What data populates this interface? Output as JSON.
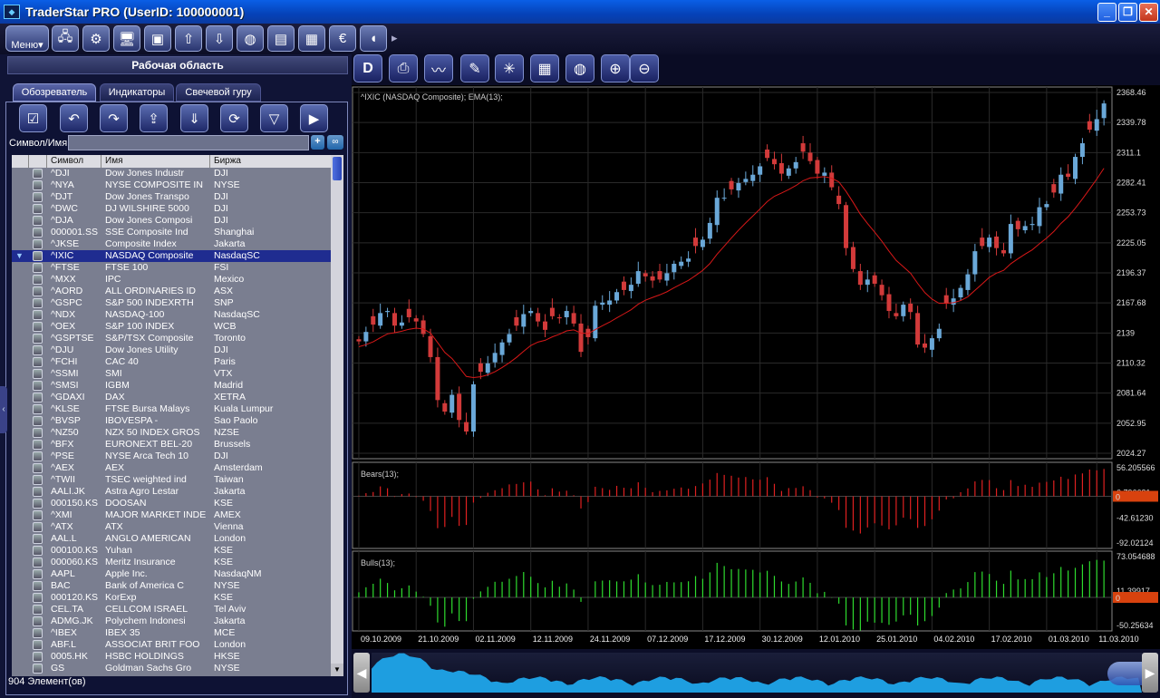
{
  "window": {
    "title": "TraderStar PRO (UserID: 100000001)",
    "app_icon": "ts-logo-icon",
    "minimize": "_",
    "maximize": "❐",
    "close": "✕"
  },
  "toolbar": {
    "menu_label": "Меню",
    "icons": [
      "network-icon",
      "settings-icon",
      "monitor-icon",
      "display-icon",
      "upload-icon",
      "download-icon",
      "globe-icon",
      "book-icon",
      "newspaper-icon",
      "euro-icon",
      "speaker-icon"
    ],
    "more": "▸"
  },
  "left_panel": {
    "title": "Рабочая область",
    "tabs": [
      "Обозреватель",
      "Индикаторы",
      "Свечевой гуру"
    ],
    "active_tab": 0,
    "symbol_label": "Символ/Имя:",
    "symbol_value": "",
    "columns": [
      "Символ",
      "Имя",
      "Биржа"
    ],
    "rows": [
      [
        "^DJI",
        "Dow Jones Industr",
        "DJI"
      ],
      [
        "^NYA",
        "NYSE COMPOSITE IN",
        "NYSE"
      ],
      [
        "^DJT",
        "Dow Jones Transpo",
        "DJI"
      ],
      [
        "^DWC",
        "DJ WILSHIRE 5000",
        "DJI"
      ],
      [
        "^DJA",
        "Dow Jones Composi",
        "DJI"
      ],
      [
        "000001.SS",
        "SSE Composite Ind",
        "Shanghai"
      ],
      [
        "^JKSE",
        "Composite Index",
        "Jakarta"
      ],
      [
        "^IXIC",
        "NASDAQ Composite",
        "NasdaqSC"
      ],
      [
        "^FTSE",
        "FTSE 100",
        "FSI"
      ],
      [
        "^MXX",
        "IPC",
        "Mexico"
      ],
      [
        "^AORD",
        "ALL ORDINARIES ID",
        "ASX"
      ],
      [
        "^GSPC",
        "S&P 500 INDEXRTH",
        "SNP"
      ],
      [
        "^NDX",
        "NASDAQ-100",
        "NasdaqSC"
      ],
      [
        "^OEX",
        "S&P 100 INDEX",
        "WCB"
      ],
      [
        "^GSPTSE",
        "S&P/TSX Composite",
        "Toronto"
      ],
      [
        "^DJU",
        "Dow Jones Utility",
        "DJI"
      ],
      [
        "^FCHI",
        "CAC 40",
        "Paris"
      ],
      [
        "^SSMI",
        "SMI",
        "VTX"
      ],
      [
        "^SMSI",
        "IGBM",
        "Madrid"
      ],
      [
        "^GDAXI",
        "DAX",
        "XETRA"
      ],
      [
        "^KLSE",
        "FTSE Bursa Malays",
        "Kuala Lumpur"
      ],
      [
        "^BVSP",
        "IBOVESPA    -",
        "Sao Paolo"
      ],
      [
        "^NZ50",
        "NZX 50 INDEX GROS",
        "NZSE"
      ],
      [
        "^BFX",
        "EURONEXT BEL-20",
        "Brussels"
      ],
      [
        "^PSE",
        "NYSE Arca Tech 10",
        "DJI"
      ],
      [
        "^AEX",
        "AEX",
        "Amsterdam"
      ],
      [
        "^TWII",
        "TSEC weighted ind",
        "Taiwan"
      ],
      [
        "AALI.JK",
        "Astra Agro Lestar",
        "Jakarta"
      ],
      [
        "000150.KS",
        "DOOSAN",
        "KSE"
      ],
      [
        "^XMI",
        "MAJOR MARKET INDE",
        "AMEX"
      ],
      [
        "^ATX",
        "ATX",
        "Vienna"
      ],
      [
        "AAL.L",
        "ANGLO AMERICAN",
        "London"
      ],
      [
        "000100.KS",
        "Yuhan",
        "KSE"
      ],
      [
        "000060.KS",
        "Meritz Insurance",
        "KSE"
      ],
      [
        "AAPL",
        "Apple Inc.",
        "NasdaqNM"
      ],
      [
        "BAC",
        "Bank of America C",
        "NYSE"
      ],
      [
        "000120.KS",
        "KorExp",
        "KSE"
      ],
      [
        "CEL.TA",
        "CELLCOM ISRAEL",
        "Tel Aviv"
      ],
      [
        "ADMG.JK",
        "Polychem Indonesi",
        "Jakarta"
      ],
      [
        "^IBEX",
        "IBEX 35",
        "MCE"
      ],
      [
        "ABF.L",
        "ASSOCIAT BRIT FOO",
        "London"
      ],
      [
        "0005.HK",
        "HSBC HOLDINGS",
        "HKSE"
      ],
      [
        "GS",
        "Goldman Sachs Gro",
        "NYSE"
      ]
    ],
    "selected_index": 7,
    "count_label": "904 Элемент(ов)"
  },
  "chart_data": {
    "type": "candlestick",
    "title": "^IXIC (NASDAQ Composite); EMA(13);",
    "ytick_labels": [
      "2368.46",
      "2339.78",
      "2311.1",
      "2282.41",
      "2253.73",
      "2225.05",
      "2196.37",
      "2167.68",
      "2139",
      "2110.32",
      "2081.64",
      "2052.95",
      "2024.27"
    ],
    "ylim": [
      2024.27,
      2368.46
    ],
    "xtick_labels": [
      "09.10.2009",
      "21.10.2009",
      "02.11.2009",
      "12.11.2009",
      "24.11.2009",
      "07.12.2009",
      "17.12.2009",
      "30.12.2009",
      "12.01.2010",
      "25.01.2010",
      "04.02.2010",
      "17.02.2010",
      "01.03.2010",
      "11.03.2010"
    ],
    "xtick_index": [
      0,
      8,
      16,
      24,
      32,
      40,
      48,
      56,
      64,
      72,
      80,
      88,
      96,
      103
    ],
    "close": [
      2131,
      2140,
      2147,
      2158,
      2160,
      2146,
      2149,
      2154,
      2150,
      2138,
      2116,
      2075,
      2064,
      2080,
      2056,
      2045,
      2090,
      2102,
      2110,
      2120,
      2130,
      2138,
      2146,
      2157,
      2160,
      2150,
      2142,
      2155,
      2153,
      2160,
      2148,
      2121,
      2135,
      2165,
      2168,
      2170,
      2178,
      2180,
      2185,
      2198,
      2193,
      2189,
      2190,
      2196,
      2205,
      2207,
      2210,
      2222,
      2228,
      2244,
      2268,
      2268,
      2276,
      2282,
      2286,
      2290,
      2298,
      2306,
      2300,
      2291,
      2296,
      2302,
      2312,
      2303,
      2291,
      2292,
      2278,
      2262,
      2220,
      2200,
      2185,
      2190,
      2186,
      2175,
      2160,
      2155,
      2166,
      2159,
      2128,
      2125,
      2134,
      2143,
      2167,
      2172,
      2182,
      2195,
      2217,
      2222,
      2230,
      2220,
      2215,
      2243,
      2238,
      2241,
      2243,
      2259,
      2262,
      2273,
      2290,
      2288,
      2307,
      2320,
      2333,
      2343,
      2358
    ],
    "ema_label": "EMA(13)",
    "bears": {
      "label": "Bears(13);",
      "ytick_labels": [
        "56.205566",
        "6.796631",
        "-42.61230",
        "-92.02124"
      ],
      "current_label": "0",
      "ylim": [
        -92.02,
        56.21
      ]
    },
    "bulls": {
      "label": "Bulls(13);",
      "ytick_labels": [
        "73.054688",
        "11.39917",
        "-50.25634"
      ],
      "current_label": "0",
      "ylim": [
        -50.26,
        73.05
      ]
    }
  },
  "chart_toolbar": {
    "icons": [
      "data-icon",
      "print-icon",
      "line-chart-icon",
      "draw-icon",
      "crosshair-icon",
      "grid-icon",
      "globe-icon",
      "zoom-in-icon",
      "zoom-out-icon"
    ],
    "data_button_label": "D"
  },
  "navigator": {
    "left_arrow": "◀",
    "right_arrow": "▶"
  },
  "colors": {
    "bull": "#6aa8d8",
    "bear": "#d23a3a",
    "ema": "#d81818",
    "bulls_bar": "#2edb2e",
    "bears_bar": "#e02020",
    "grid": "#2a2a2a"
  }
}
